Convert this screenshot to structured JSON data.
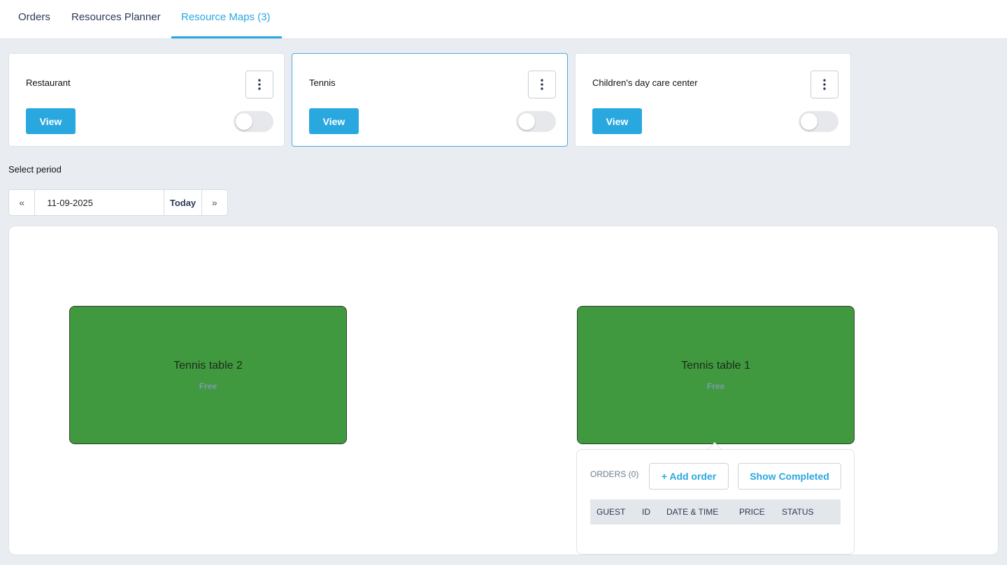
{
  "tabs": [
    {
      "label": "Orders",
      "active": false
    },
    {
      "label": "Resources Planner",
      "active": false
    },
    {
      "label": "Resource Maps (3)",
      "active": true
    }
  ],
  "maps": [
    {
      "title": "Restaurant",
      "view_label": "View",
      "enabled": false,
      "selected": false
    },
    {
      "title": "Tennis",
      "view_label": "View",
      "enabled": false,
      "selected": true
    },
    {
      "title": "Children's day care center",
      "view_label": "View",
      "enabled": false,
      "selected": false
    }
  ],
  "period": {
    "label": "Select period",
    "prev_icon": "«",
    "next_icon": "»",
    "date_value": "11-09-2025",
    "today_label": "Today"
  },
  "resources": [
    {
      "name": "Tennis table 2",
      "status": "Free",
      "color": "#41993f"
    },
    {
      "name": "Tennis table 1",
      "status": "Free",
      "color": "#41993f"
    }
  ],
  "orders_popover": {
    "title": "ORDERS (0)",
    "add_label": "+ Add order",
    "completed_label": "Show Completed",
    "columns": [
      "GUEST",
      "ID",
      "DATE & TIME",
      "PRICE",
      "STATUS"
    ]
  },
  "colors": {
    "accent": "#29a8e0",
    "resource_free": "#41993f",
    "background": "#e9edf2"
  }
}
